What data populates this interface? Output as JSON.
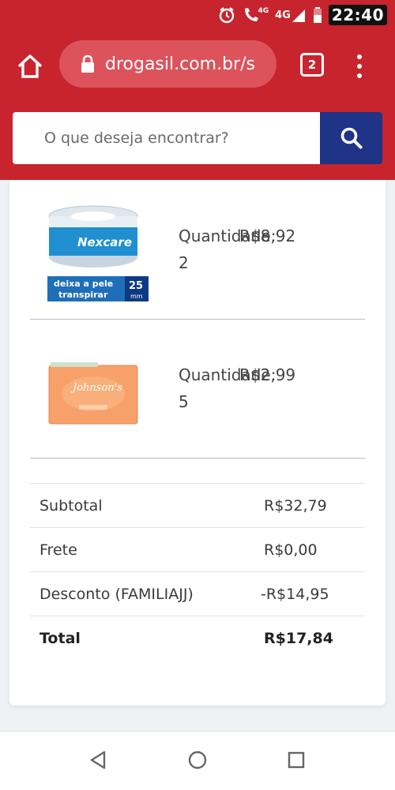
{
  "status_bar": {
    "signal_label_1": "4G",
    "signal_label_2": "4G",
    "time": "22:40",
    "icons": [
      "alarm-icon",
      "wifi-call-icon",
      "signal-icon",
      "battery-icon"
    ]
  },
  "browser": {
    "url": "drogasil.com.br/s",
    "tab_count": "2",
    "icons": [
      "home-icon",
      "lock-icon",
      "menu-dots-icon"
    ]
  },
  "search": {
    "placeholder": "O que deseja encontrar?",
    "icon": "search-icon"
  },
  "products": [
    {
      "qty_label": "Quantidade:",
      "qty": "2",
      "price": "R$8,92",
      "image_text": [
        "Nexcare",
        "deixa a pele",
        "transpirar",
        "25",
        "mm"
      ]
    },
    {
      "qty_label": "Quantidade:",
      "qty": "5",
      "price": "R$2,99",
      "image_text": [
        "Johnson's"
      ]
    }
  ],
  "summary": {
    "subtotal_label": "Subtotal",
    "subtotal_value": "R$32,79",
    "frete_label": "Frete",
    "frete_value": "R$0,00",
    "desconto_label": "Desconto (FAMILIAJJ)",
    "desconto_value": "-R$14,95",
    "total_label": "Total",
    "total_value": "R$17,84"
  },
  "colors": {
    "brand_red": "#c8242e",
    "search_button": "#1f3387"
  },
  "nav": {
    "icons": [
      "back-icon",
      "home-circle-icon",
      "recents-icon"
    ]
  }
}
